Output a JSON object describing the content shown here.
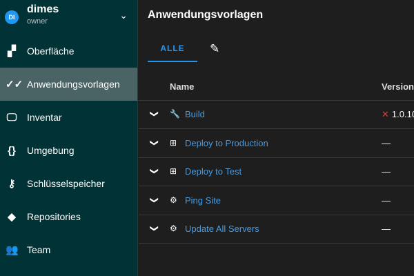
{
  "user": {
    "initials": "DI",
    "name": "dimes",
    "role": "owner"
  },
  "sidebar": {
    "items": [
      {
        "label": "Oberfläche",
        "icon": "dashboard-icon",
        "glyph": "▞"
      },
      {
        "label": "Anwendungsvorlagen",
        "icon": "done-all-icon",
        "glyph": "✓✓",
        "active": true
      },
      {
        "label": "Inventar",
        "icon": "monitor-icon",
        "glyph": "🖵"
      },
      {
        "label": "Umgebung",
        "icon": "braces-icon",
        "glyph": "{}"
      },
      {
        "label": "Schlüsselspeicher",
        "icon": "key-icon",
        "glyph": "⚷"
      },
      {
        "label": "Repositories",
        "icon": "git-icon",
        "glyph": "◆"
      },
      {
        "label": "Team",
        "icon": "people-icon",
        "glyph": "👥"
      }
    ]
  },
  "main": {
    "title": "Anwendungsvorlagen",
    "tabs": [
      {
        "label": "ALLE"
      }
    ],
    "columns": {
      "name": "Name",
      "version": "Version"
    },
    "rows": [
      {
        "name": "Build",
        "icon": "wrench-icon",
        "glyph": "🔧",
        "version": "1.0.10",
        "failed": true
      },
      {
        "name": "Deploy to Production",
        "icon": "deploy-icon",
        "glyph": "⊞",
        "version": "—"
      },
      {
        "name": "Deploy to Test",
        "icon": "deploy-icon",
        "glyph": "⊞",
        "version": "—"
      },
      {
        "name": "Ping Site",
        "icon": "gear-icon",
        "glyph": "⚙",
        "version": "—"
      },
      {
        "name": "Update All Servers",
        "icon": "gear-icon",
        "glyph": "⚙",
        "version": "—"
      }
    ]
  },
  "colors": {
    "sidebar": "#003236",
    "active": "#4a6466",
    "accent": "#2196f3",
    "error": "#e53935"
  }
}
